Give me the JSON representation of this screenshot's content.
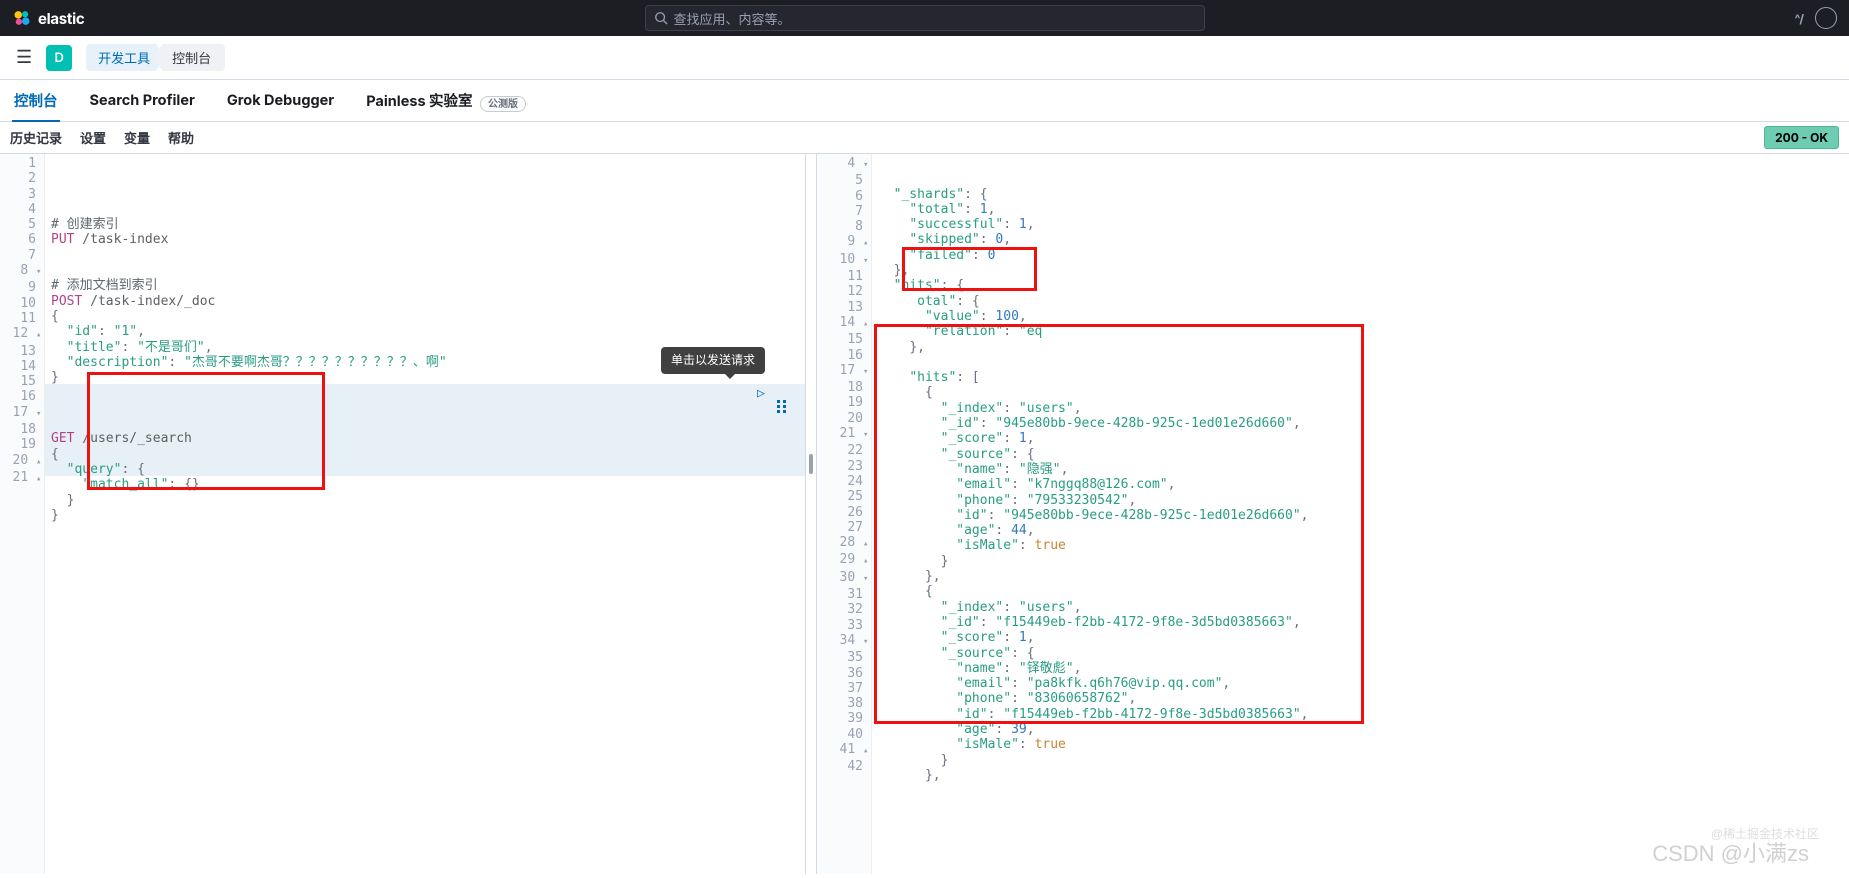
{
  "header": {
    "logo_text": "elastic",
    "search_placeholder": "查找应用、内容等。",
    "keyboard_shortcut": "^/"
  },
  "subheader": {
    "badge": "D",
    "breadcrumb1": "开发工具",
    "breadcrumb2": "控制台"
  },
  "tabs": {
    "console": "控制台",
    "profiler": "Search Profiler",
    "grok": "Grok Debugger",
    "painless": "Painless 实验室",
    "beta": "公测版"
  },
  "toolbar": {
    "history": "历史记录",
    "settings": "设置",
    "variables": "变量",
    "help": "帮助",
    "status": "200 - OK"
  },
  "tooltip": "单击以发送请求",
  "left_editor": {
    "lines": [
      "1",
      "2",
      "3",
      "4",
      "5",
      "6",
      "7",
      "8",
      "9",
      "10",
      "11",
      "12",
      "13",
      "14",
      "15",
      "16",
      "17",
      "18",
      "19",
      "20",
      "21"
    ],
    "l2_comment": "# 创建索引",
    "l3_method": "PUT",
    "l3_path": " /task-index",
    "l6_comment": "# 添加文档到索引",
    "l7_method": "POST",
    "l7_path": " /task-index/_doc",
    "l8": "{",
    "l9_k": "\"id\"",
    "l9_v": "\"1\"",
    "l10_k": "\"title\"",
    "l10_v": "\"不是哥们\"",
    "l11_k": "\"description\"",
    "l11_v": "\"杰哥不要啊杰哥？？？？？？？？？？、啊\"",
    "l12": "}",
    "l16_method": "GET",
    "l16_path": " /users/_search",
    "l17": "{",
    "l18_k": "\"query\"",
    "l19_k": "\"match_all\"",
    "l19_v": "{}",
    "l20": "  }",
    "l21": "}"
  },
  "right_editor": {
    "lines": [
      "4",
      "5",
      "6",
      "7",
      "8",
      "9",
      "10",
      "11",
      "12",
      "13",
      "14",
      "15",
      "16",
      "17",
      "18",
      "19",
      "20",
      "21",
      "22",
      "23",
      "24",
      "25",
      "26",
      "27",
      "28",
      "29",
      "30",
      "31",
      "32",
      "33",
      "34",
      "35",
      "36",
      "37",
      "38",
      "39",
      "40",
      "41",
      "42"
    ],
    "l4": "\"_shards\"",
    "l4v": "{",
    "l5": "\"total\"",
    "l5v": "1",
    "l6": "\"successful\"",
    "l6v": "1",
    "l7": "\"skipped\"",
    "l7v": "0",
    "l8": "\"failed\"",
    "l8v": "0",
    "l9": "},",
    "l10": "\"hits\"",
    "l10v": "{",
    "l11": "otal\"",
    "l11v": "{",
    "l12": "\"value\"",
    "l12v": "100",
    "l13": "\"relation\"",
    "l13v": "\"eq",
    "l14": "},",
    "l16": "\"hits\"",
    "l16v": "[",
    "l17": "{",
    "l18": "\"_index\"",
    "l18v": "\"users\"",
    "l19": "\"_id\"",
    "l19v": "\"945e80bb-9ece-428b-925c-1ed01e26d660\"",
    "l20": "\"_score\"",
    "l20v": "1",
    "l21": "\"_source\"",
    "l21v": "{",
    "l22": "\"name\"",
    "l22v": "\"隐强\"",
    "l23": "\"email\"",
    "l23v": "\"k7nggq88@126.com\"",
    "l24": "\"phone\"",
    "l24v": "\"79533230542\"",
    "l25": "\"id\"",
    "l25v": "\"945e80bb-9ece-428b-925c-1ed01e26d660\"",
    "l26": "\"age\"",
    "l26v": "44",
    "l27": "\"isMale\"",
    "l27v": "true",
    "l28": "}",
    "l29": "},",
    "l30": "{",
    "l31": "\"_index\"",
    "l31v": "\"users\"",
    "l32": "\"_id\"",
    "l32v": "\"f15449eb-f2bb-4172-9f8e-3d5bd0385663\"",
    "l33": "\"_score\"",
    "l33v": "1",
    "l34": "\"_source\"",
    "l34v": "{",
    "l35": "\"name\"",
    "l35v": "\"铎敬彪\"",
    "l36": "\"email\"",
    "l36v": "\"pa8kfk.q6h76@vip.qq.com\"",
    "l37": "\"phone\"",
    "l37v": "\"83060658762\"",
    "l38": "\"id\"",
    "l38v": "\"f15449eb-f2bb-4172-9f8e-3d5bd0385663\"",
    "l39": "\"age\"",
    "l39v": "39",
    "l40": "\"isMale\"",
    "l40v": "true",
    "l41": "}",
    "l42": "},"
  },
  "watermark1": "CSDN @小满zs",
  "watermark2": "@稀土掘金技术社区"
}
